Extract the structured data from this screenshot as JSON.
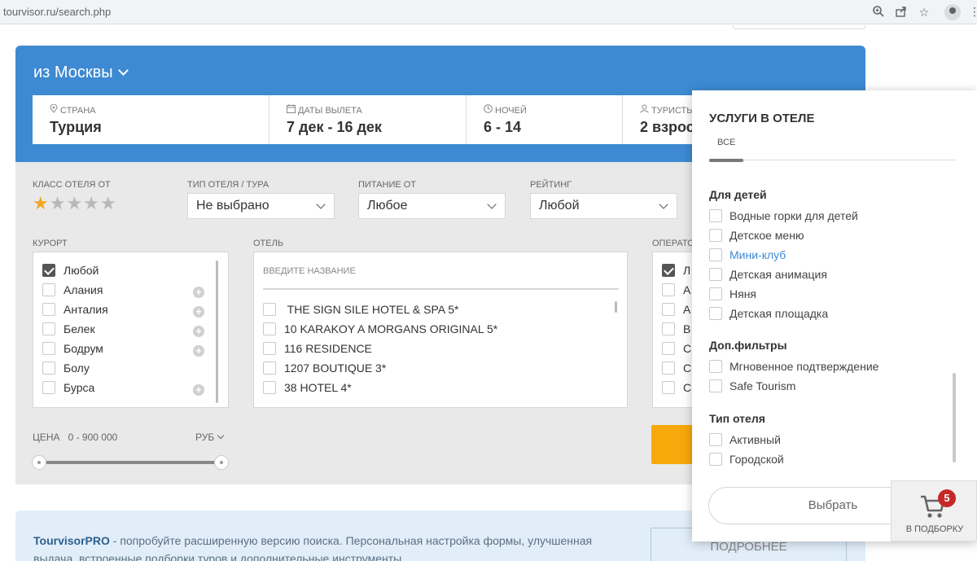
{
  "browser": {
    "url": "tourvisor.ru/search.php"
  },
  "search": {
    "from": "из Москвы",
    "params": [
      {
        "label": "СТРАНА",
        "value": "Турция",
        "icon": "pin-icon"
      },
      {
        "label": "ДАТЫ ВЫЛЕТА",
        "value": "7 дек - 16 дек",
        "icon": "calendar-icon"
      },
      {
        "label": "НОЧЕЙ",
        "value": "6 - 14",
        "icon": "clock-icon"
      },
      {
        "label": "ТУРИСТЫ",
        "value": "2 взрос",
        "icon": "user-icon"
      }
    ]
  },
  "filters": {
    "hotel_class_label": "КЛАСС ОТЕЛЯ ОТ",
    "hotel_class_stars": 1,
    "hotel_type_label": "ТИП ОТЕЛЯ / ТУРА",
    "hotel_type_value": "Не выбрано",
    "meal_label": "ПИТАНИЕ ОТ",
    "meal_value": "Любое",
    "rating_label": "РЕЙТИНГ",
    "rating_value": "Любой",
    "resort_label": "КУРОРТ",
    "resorts": [
      {
        "name": "Любой",
        "checked": true,
        "expandable": false
      },
      {
        "name": "Алания",
        "checked": false,
        "expandable": true
      },
      {
        "name": "Анталия",
        "checked": false,
        "expandable": true
      },
      {
        "name": "Белек",
        "checked": false,
        "expandable": true
      },
      {
        "name": "Бодрум",
        "checked": false,
        "expandable": true
      },
      {
        "name": "Болу",
        "checked": false,
        "expandable": false
      },
      {
        "name": "Бурса",
        "checked": false,
        "expandable": true
      }
    ],
    "hotel_label": "ОТЕЛЬ",
    "hotel_placeholder": "ВВЕДИТЕ НАЗВАНИЕ",
    "hotels": [
      " THE SIGN SILE HOTEL & SPA 5*",
      "10 KARAKOY A MORGANS ORIGINAL 5*",
      "116 RESIDENCE",
      "1207 BOUTIQUE 3*",
      "38 HOTEL 4*"
    ],
    "operator_label": "ОПЕРАТО",
    "operators": [
      "Л",
      "А",
      "А",
      "В",
      "С",
      "С",
      "С"
    ],
    "price_label": "ЦЕНА",
    "price_range": "0 -  900 000",
    "currency": "РУБ",
    "price_min": 0,
    "price_max": 900000
  },
  "services_panel": {
    "title": "УСЛУГИ В ОТЕЛЕ",
    "tab_all": "ВСЕ",
    "sections": [
      {
        "title": "Для детей",
        "items": [
          {
            "label": "Водные горки для детей",
            "highlight": false
          },
          {
            "label": "Детское меню",
            "highlight": false
          },
          {
            "label": "Мини-клуб",
            "highlight": true
          },
          {
            "label": "Детская анимация",
            "highlight": false
          },
          {
            "label": "Няня",
            "highlight": false
          },
          {
            "label": "Детская площадка",
            "highlight": false
          }
        ]
      },
      {
        "title": "Доп.фильтры",
        "items": [
          {
            "label": "Мгновенное подтверждение",
            "highlight": false
          },
          {
            "label": "Safe Tourism",
            "highlight": false
          }
        ]
      },
      {
        "title": "Тип отеля",
        "items": [
          {
            "label": "Активный",
            "highlight": false
          },
          {
            "label": "Городской",
            "highlight": false
          }
        ]
      }
    ],
    "choose_button": "Выбрать"
  },
  "promo": {
    "brand": "TourvisorPRO",
    "text": " - попробуйте расширенную версию поиска. Персональная настройка формы, улучшенная выдача, встроенные подборки туров и дополнительные инструменты.",
    "button": "ПОДРОБНЕЕ"
  },
  "cart": {
    "count": "5",
    "label": "В ПОДБОРКУ"
  },
  "colors": {
    "brand_blue": "#3e8ad2",
    "accent_orange": "#f7a80a",
    "star": "#f5a623",
    "badge_red": "#c62828"
  }
}
